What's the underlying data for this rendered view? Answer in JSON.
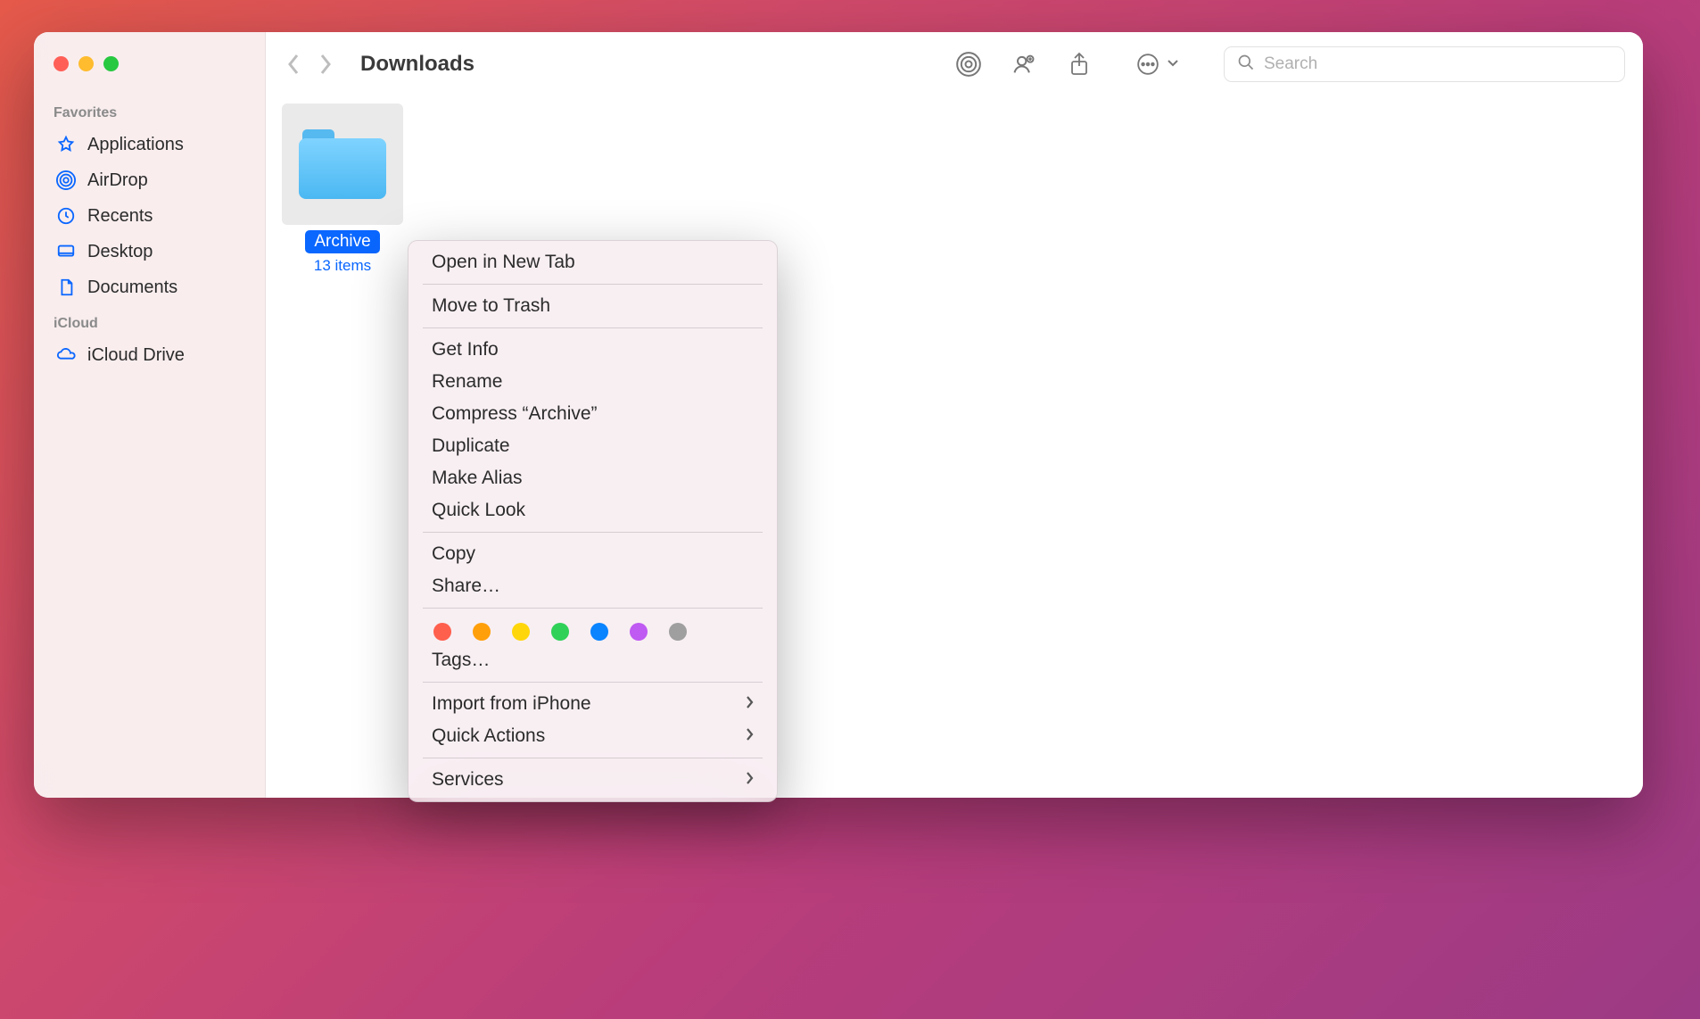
{
  "window": {
    "title": "Downloads",
    "search_placeholder": "Search"
  },
  "sidebar": {
    "sections": {
      "favorites": {
        "label": "Favorites",
        "items": [
          {
            "label": "Applications",
            "icon": "applications-icon"
          },
          {
            "label": "AirDrop",
            "icon": "airdrop-icon"
          },
          {
            "label": "Recents",
            "icon": "recents-icon"
          },
          {
            "label": "Desktop",
            "icon": "desktop-icon"
          },
          {
            "label": "Documents",
            "icon": "documents-icon"
          }
        ]
      },
      "icloud": {
        "label": "iCloud",
        "items": [
          {
            "label": "iCloud Drive",
            "icon": "icloud-icon"
          }
        ]
      }
    }
  },
  "content": {
    "selected_item": {
      "name": "Archive",
      "subtitle": "13 items",
      "type": "folder"
    }
  },
  "context_menu": {
    "groups": [
      {
        "items": [
          "Open in New Tab"
        ]
      },
      {
        "items": [
          "Move to Trash"
        ]
      },
      {
        "items": [
          "Get Info",
          "Rename",
          "Compress “Archive”",
          "Duplicate",
          "Make Alias",
          "Quick Look"
        ]
      },
      {
        "items": [
          "Copy",
          "Share…"
        ]
      }
    ],
    "tag_colors": [
      "red",
      "orange",
      "yellow",
      "green",
      "blue",
      "purple",
      "gray"
    ],
    "tags_label": "Tags…",
    "submenus": [
      "Import from iPhone",
      "Quick Actions"
    ],
    "services_label": "Services"
  }
}
